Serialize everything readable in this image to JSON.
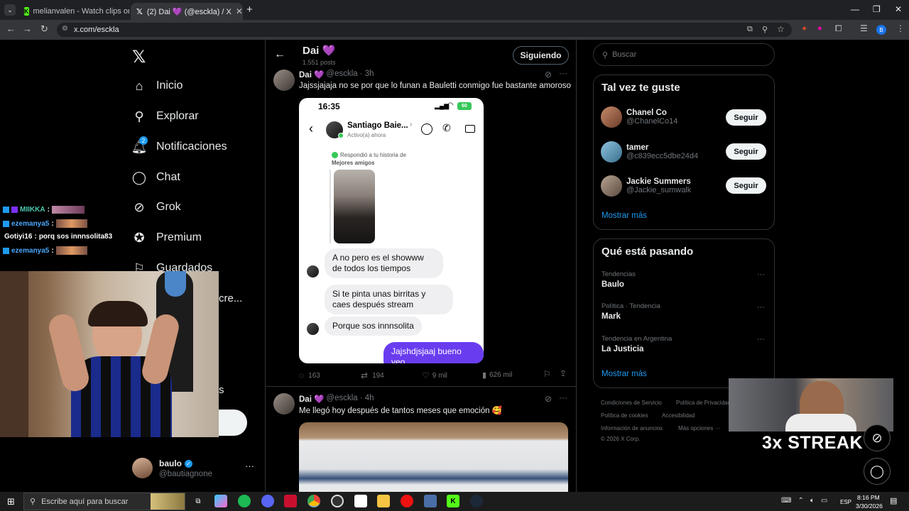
{
  "browser": {
    "tabs": [
      {
        "title": "melianvalen - Watch clips on K",
        "icon": "kick-icon"
      },
      {
        "title": "(2) Dai 💜 (@esckla) / X",
        "icon": "x-icon"
      }
    ],
    "url": "x.com/esckla"
  },
  "sidebar": {
    "items": [
      {
        "label": "Inicio",
        "icon": "home-icon"
      },
      {
        "label": "Explorar",
        "icon": "search-icon"
      },
      {
        "label": "Notificaciones",
        "icon": "bell-icon",
        "badge": "2"
      },
      {
        "label": "Chat",
        "icon": "chat-icon"
      },
      {
        "label": "Grok",
        "icon": "grok-icon"
      },
      {
        "label": "Premium",
        "icon": "premium-icon"
      },
      {
        "label": "Guardados",
        "icon": "bookmark-icon"
      },
      {
        "label": "cre...",
        "icon": "create-icon"
      }
    ],
    "post_letter": "s",
    "account": {
      "name": "baulo",
      "handle": "@bautiagnone"
    }
  },
  "profile_header": {
    "name": "Dai 💜",
    "posts": "1.551 posts",
    "follow_label": "Siguiendo"
  },
  "posts": [
    {
      "author": "Dai 💜",
      "handle": "@esckla",
      "time": "· 3h",
      "text": "Jajssjajaja no se por que lo funan a Bauletti conmigo fue bastante amoroso",
      "stats": {
        "replies": "163",
        "reposts": "194",
        "likes": "9 mil",
        "views": "626 mil"
      },
      "screenshot": {
        "time": "16:35",
        "battery": "60",
        "contact": "Santiago Baie...",
        "status": "Activo(a) ahora",
        "replied_to": "Respondió a tu historia de",
        "close_friends": "Mejores amigos",
        "messages": [
          "A no pero es el showww de todos los tiempos",
          "Si te pinta unas birritas y caes después stream",
          "Porque sos innnsolita",
          "Jajshdjsjaaj bueno veo"
        ]
      }
    },
    {
      "author": "Dai 💜",
      "handle": "@esckla",
      "time": "· 4h",
      "text": "Me llegó hoy después de tantos meses que emoción 🥰"
    }
  ],
  "right": {
    "search_placeholder": "Buscar",
    "suggestions_title": "Tal vez te guste",
    "suggestions": [
      {
        "name": "Chanel Co",
        "handle": "@ChanelCo14",
        "button": "Seguir"
      },
      {
        "name": "tamer",
        "handle": "@c839ecc5dbe24d4",
        "button": "Seguir"
      },
      {
        "name": "Jackie Summers",
        "handle": "@Jackie_sumwalk",
        "button": "Seguir"
      }
    ],
    "show_more": "Mostrar más",
    "trends_title": "Qué está pasando",
    "trends": [
      {
        "context": "Tendencias",
        "name": "Baulo"
      },
      {
        "context": "Política · Tendencia",
        "name": "Mark"
      },
      {
        "context": "Tendencia en Argentina",
        "name": "La Justicia"
      }
    ],
    "show_more_2": "Mostrar más",
    "footer": [
      "Condiciones de Servicio",
      "Política de Privacidad",
      "Política de cookies",
      "Accesibilidad",
      "Información de anuncios",
      "Más opciones ···",
      "© 2026 X Corp."
    ]
  },
  "stream_chat": [
    {
      "user": "MIIKKA",
      "color": "#4ec9b0",
      "text": ""
    },
    {
      "user": "ezemanya5",
      "color": "#4aa8ff",
      "text": ""
    },
    {
      "user": "Gotiyi16",
      "color": "#ffffff",
      "text": "porq sos innnsolita83"
    },
    {
      "user": "ezemanya5",
      "color": "#4aa8ff",
      "text": ""
    }
  ],
  "overlay": {
    "streak_text": "3x STREAK"
  },
  "taskbar": {
    "search_placeholder": "Escribe aquí para buscar",
    "lang": "ESP",
    "time": "8:16 PM",
    "date": "3/30/2026"
  }
}
